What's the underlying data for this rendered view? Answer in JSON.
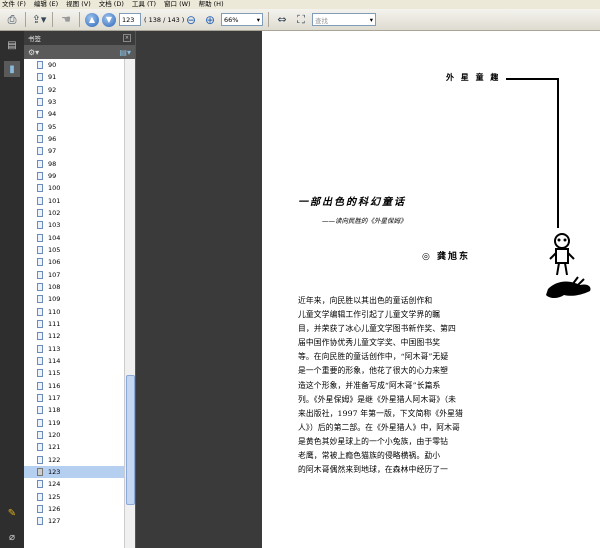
{
  "menu": [
    "文件 (F)",
    "编辑 (E)",
    "视图 (V)",
    "文档 (D)",
    "工具 (T)",
    "窗口 (W)",
    "帮助 (H)"
  ],
  "toolbar": {
    "page_current": "123",
    "page_count": "( 138 / 143 )",
    "zoom": "66%",
    "search_placeholder": "查找"
  },
  "panel": {
    "title": "书签",
    "close": "×",
    "pages": [
      "90",
      "91",
      "92",
      "93",
      "94",
      "95",
      "96",
      "97",
      "98",
      "99",
      "100",
      "101",
      "102",
      "103",
      "104",
      "105",
      "106",
      "107",
      "108",
      "109",
      "110",
      "111",
      "112",
      "113",
      "114",
      "115",
      "116",
      "117",
      "118",
      "119",
      "120",
      "121",
      "122",
      "123",
      "124",
      "125",
      "126",
      "127"
    ],
    "selected_index": 33,
    "scroll_position_fraction": 0.88
  },
  "document": {
    "column_title": "外 星 童 趣",
    "article_title": "一部出色的科幻童话",
    "article_subtitle": "——读向民胜的《外星保姆》",
    "author": "◎ 龚旭东",
    "body_lines": [
      "近年来，向民胜以其出色的童话创作和",
      "儿童文学编辑工作引起了儿童文学界的瞩",
      "目，并荣获了冰心儿童文学图书新作奖、第四",
      "届中国作协优秀儿童文学奖、中国图书奖",
      "等。在向民胜的童话创作中，“阿木哥”无疑",
      "是一个重要的形象，他花了很大的心力来塑",
      "造这个形象，并准备写成“阿木哥”长篇系",
      "列。《外星保姆》是继《外星猎人阿木哥》（未",
      "来出版社，1997 年第一版，下文简称《外星猎",
      "人》）后的第二部。在《外星猎人》中，阿木哥",
      "是黄色其妙星球上的一个小兔族，由于零钻",
      "老鹰，常被上瘾色猫族的侵略横祸。勐小",
      "的阿木哥偶然来到地球，在森林中经历了一"
    ]
  },
  "icons": [
    "print-icon",
    "export-icon",
    "hand-tool-icon",
    "up-arrow-icon",
    "down-arrow-icon",
    "zoom-out-icon",
    "zoom-in-icon",
    "fit-width-icon",
    "fit-page-icon",
    "pages-icon",
    "bookmarks-icon",
    "options-icon",
    "expand-icon",
    "sign-icon",
    "attachment-icon"
  ]
}
